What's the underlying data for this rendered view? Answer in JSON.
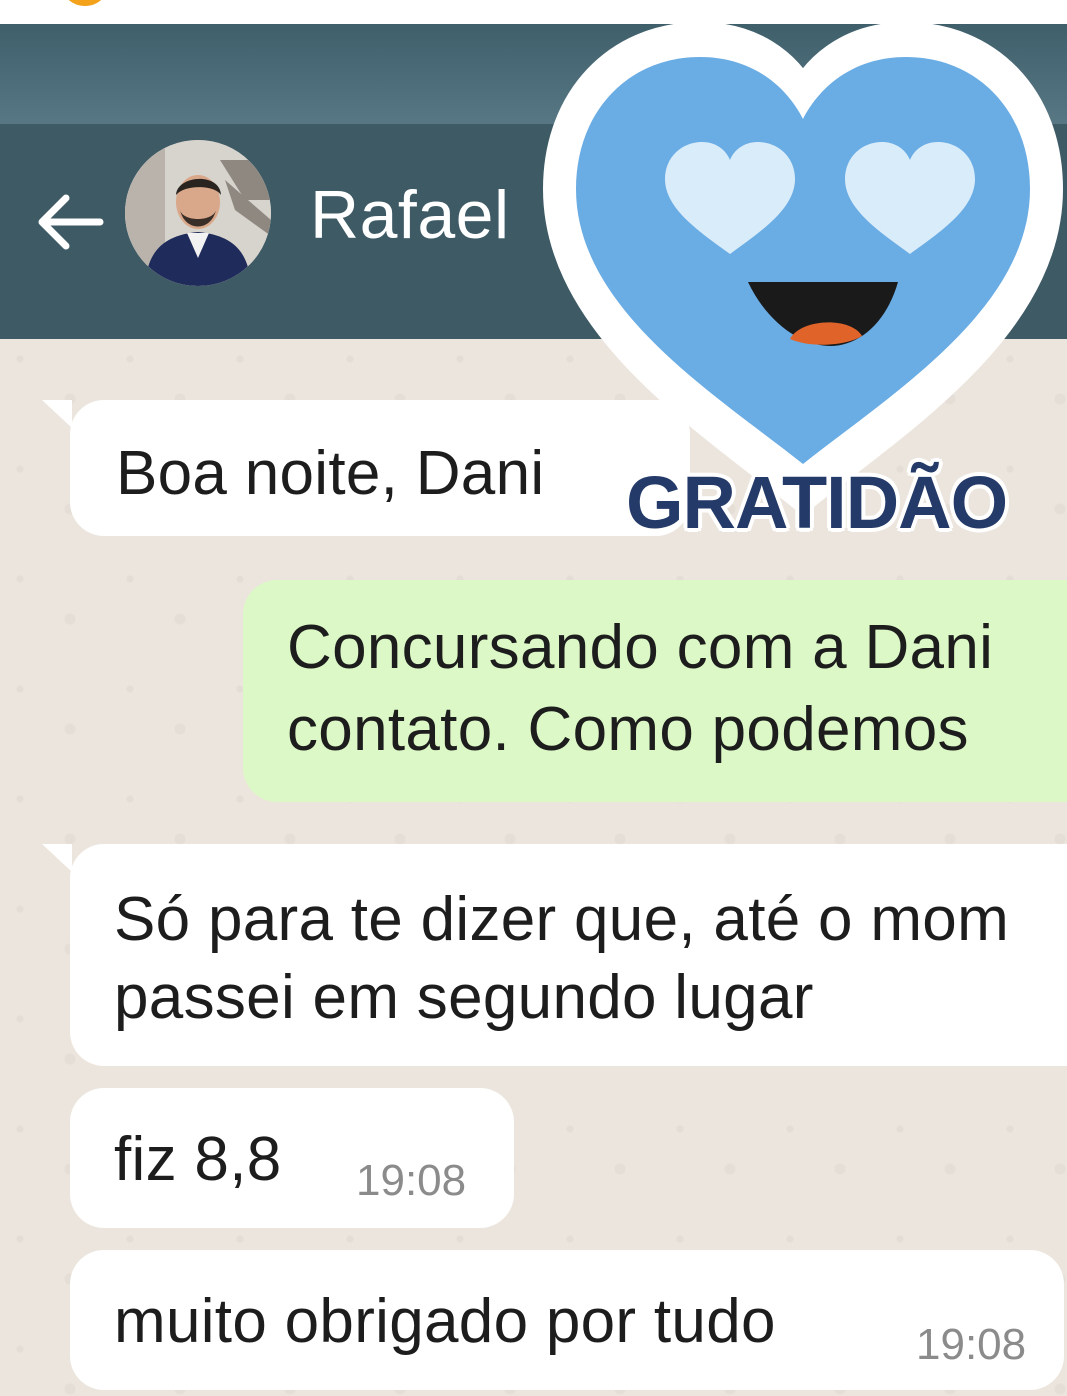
{
  "header": {
    "contact_name": "Rafael"
  },
  "icons": {
    "back": "arrow-left-icon",
    "avatar": "contact-avatar"
  },
  "messages": [
    {
      "direction": "incoming",
      "text": "Boa noite, Dani"
    },
    {
      "direction": "outgoing",
      "lines": [
        "Concursando com a Dani",
        "contato. Como podemos"
      ]
    },
    {
      "direction": "incoming",
      "lines": [
        "Só para te dizer que, até o mom",
        "passei em segundo lugar"
      ]
    },
    {
      "direction": "incoming",
      "text": "fiz 8,8",
      "time": "19:08"
    },
    {
      "direction": "incoming",
      "text": "muito obrigado por tudo",
      "time": "19:08"
    }
  ],
  "sticker": {
    "caption": "GRATIDÃO",
    "icon": "heart-eyes-smiley-sticker"
  },
  "colors": {
    "header": "#3d5a65",
    "chat_background": "#ece5dd",
    "incoming_bubble": "#ffffff",
    "outgoing_bubble": "#dcf8c6",
    "sticker_heart": "#6aace4",
    "sticker_text": "#243a69"
  }
}
